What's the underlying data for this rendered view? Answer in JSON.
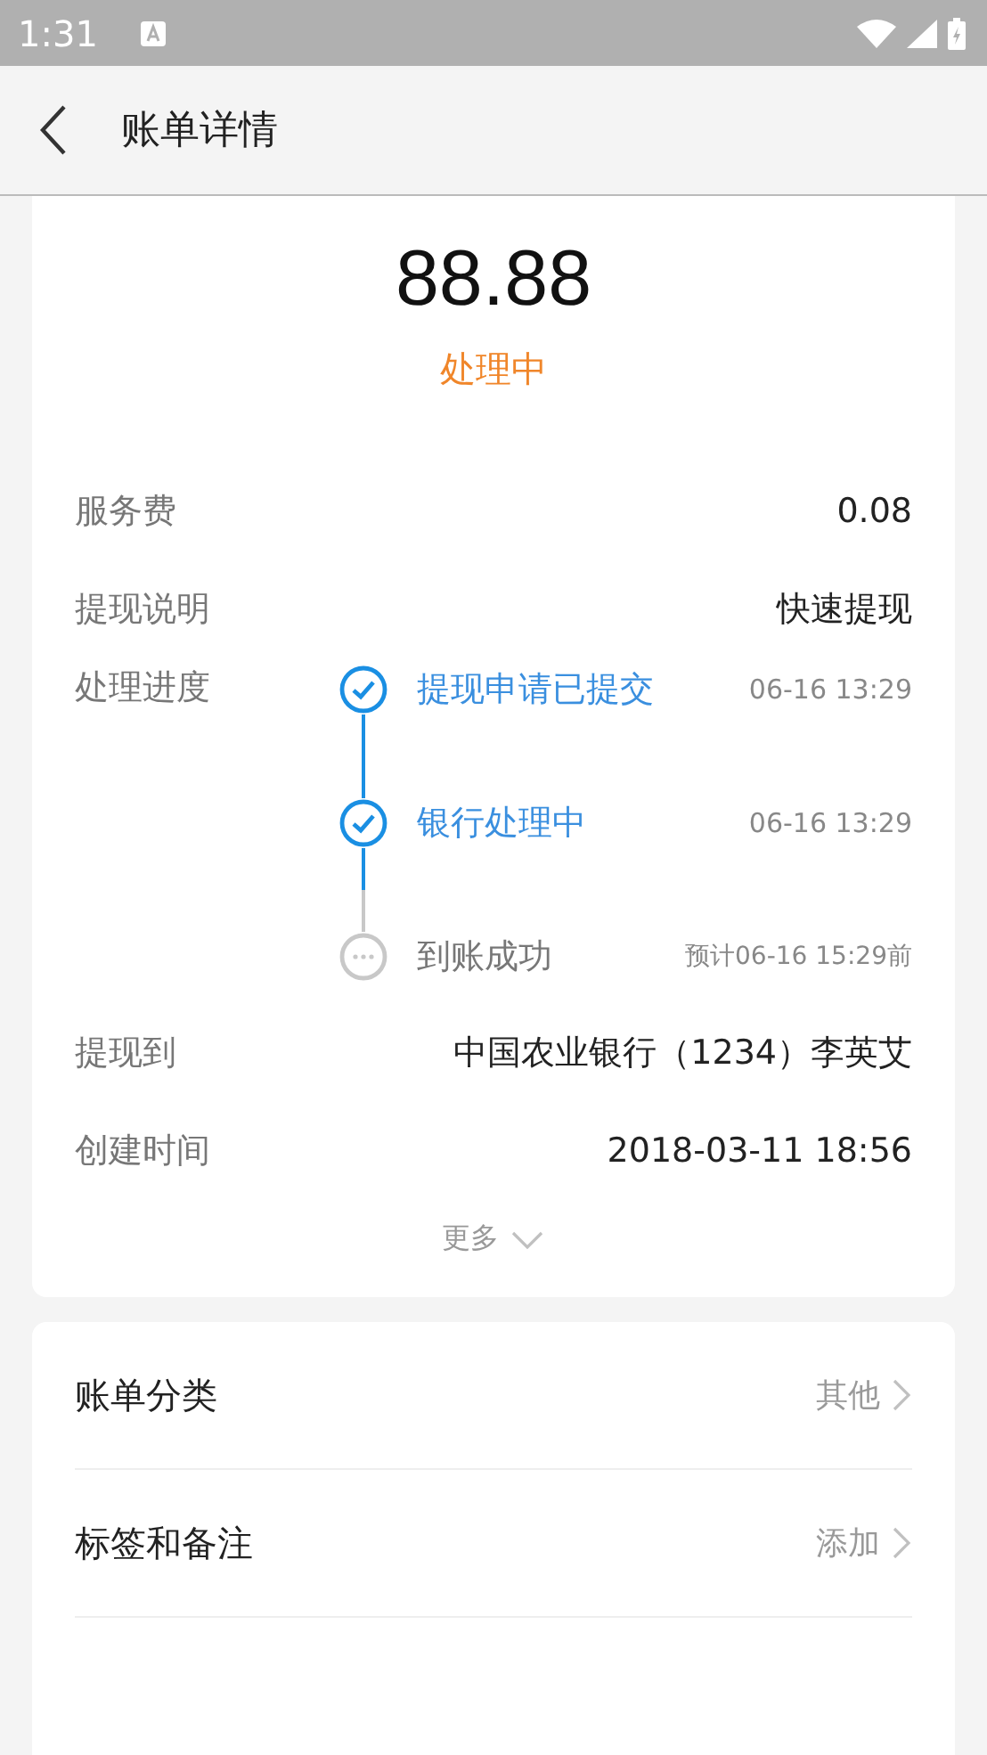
{
  "status_bar": {
    "time": "1:31"
  },
  "header": {
    "title": "账单详情"
  },
  "summary": {
    "amount": "88.88",
    "status": "处理中"
  },
  "details": [
    {
      "label": "服务费",
      "value": "0.08"
    },
    {
      "label": "提现说明",
      "value": "快速提现"
    }
  ],
  "progress": {
    "label": "处理进度",
    "steps": [
      {
        "title": "提现申请已提交",
        "time": "06-16 13:29",
        "done": true
      },
      {
        "title": "银行处理中",
        "time": "06-16 13:29",
        "done": true
      },
      {
        "title": "到账成功",
        "time": "预计06-16 15:29前",
        "done": false
      }
    ]
  },
  "details_more": [
    {
      "label": "提现到",
      "value": "中国农业银行（1234）李英艾"
    },
    {
      "label": "创建时间",
      "value": "2018-03-11 18:56"
    }
  ],
  "more_link": "更多",
  "menu": [
    {
      "label": "账单分类",
      "value": "其他"
    },
    {
      "label": "标签和备注",
      "value": "添加"
    }
  ]
}
